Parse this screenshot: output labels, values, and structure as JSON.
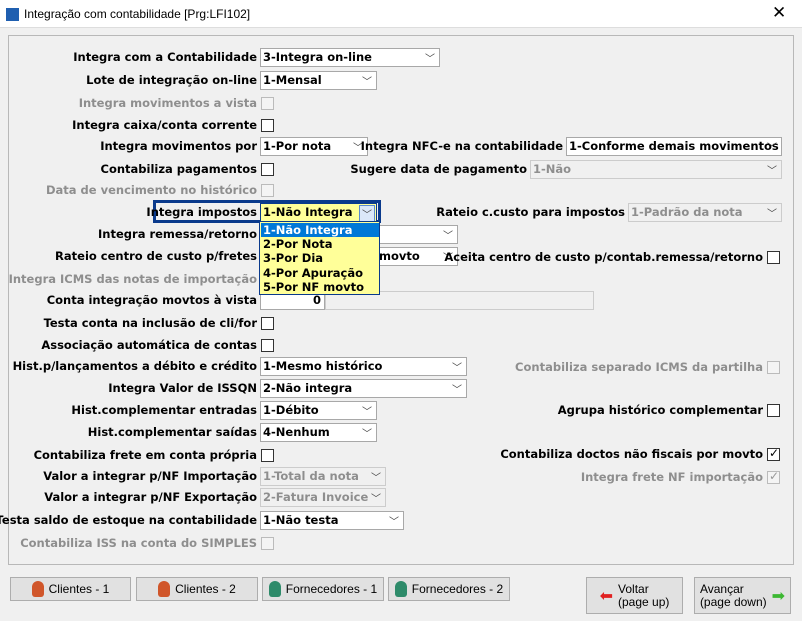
{
  "window": {
    "title": "Integração com contabilidade [Prg:LFI102]",
    "close": "✕"
  },
  "left": {
    "integra_contab": {
      "label": "Integra com a Contabilidade",
      "value": "3-Integra on-line"
    },
    "lote": {
      "label": "Lote de integração on-line",
      "value": "1-Mensal"
    },
    "mov_vista": {
      "label": "Integra movimentos a vista"
    },
    "caixa": {
      "label": "Integra caixa/conta corrente"
    },
    "mov_por": {
      "label": "Integra movimentos por",
      "value": "1-Por nota"
    },
    "pagamentos": {
      "label": "Contabiliza pagamentos"
    },
    "venc_hist": {
      "label": "Data de vencimento no histórico"
    },
    "impostos": {
      "label": "Integra impostos",
      "value": "1-Não Integra"
    },
    "remessa": {
      "label": "Integra remessa/retorno"
    },
    "rateio_fretes": {
      "label": "Rateio centro de custo p/fretes",
      "value": "movto"
    },
    "icms_import": {
      "label": "Integra ICMS das notas de importação"
    },
    "conta_vista": {
      "label": "Conta integração movtos à vista",
      "value": "0"
    },
    "testa_conta": {
      "label": "Testa conta na inclusão de cli/for"
    },
    "assoc": {
      "label": "Associação automática de contas"
    },
    "hist_lanc": {
      "label": "Hist.p/lançamentos a débito e crédito",
      "value": "1-Mesmo histórico"
    },
    "issqn": {
      "label": "Integra Valor de ISSQN",
      "value": "2-Não integra"
    },
    "hist_ent": {
      "label": "Hist.complementar entradas",
      "value": "1-Débito"
    },
    "hist_sai": {
      "label": "Hist.complementar saídas",
      "value": "4-Nenhum"
    },
    "frete": {
      "label": "Contabiliza frete em conta própria"
    },
    "val_imp": {
      "label": "Valor a integrar p/NF Importação",
      "value": "1-Total da nota"
    },
    "val_exp": {
      "label": "Valor a integrar p/NF Exportação",
      "value": "2-Fatura Invoice"
    },
    "testa_saldo": {
      "label": "Testa saldo de estoque na contabilidade",
      "value": "1-Não testa"
    },
    "iss_simples": {
      "label": "Contabiliza ISS na conta do SIMPLES"
    }
  },
  "right": {
    "nfce": {
      "label": "Integra NFC-e na contabilidade",
      "value": "1-Conforme demais movimentos"
    },
    "sugere": {
      "label": "Sugere data de pagamento",
      "value": "1-Não"
    },
    "rateio_imp": {
      "label": "Rateio c.custo para impostos",
      "value": "1-Padrão da nota"
    },
    "aceita": {
      "label": "Aceita centro de custo p/contab.remessa/retorno",
      "checked": false
    },
    "icms_partilha": {
      "label": "Contabiliza separado ICMS da partilha",
      "checked": false
    },
    "agrupa": {
      "label": "Agrupa histórico complementar",
      "checked": false
    },
    "doctos": {
      "label": "Contabiliza doctos não fiscais por movto",
      "checked": true
    },
    "frete_imp": {
      "label": "Integra frete NF importação",
      "checked": true
    }
  },
  "dropdown": {
    "options": [
      "1-Não Integra",
      "2-Por Nota",
      "3-Por Dia",
      "4-Por Apuração",
      "5-Por NF movto"
    ],
    "selected": 0
  },
  "buttons": {
    "clientes1": "Clientes - 1",
    "clientes2": "Clientes - 2",
    "fornec1": "Fornecedores - 1",
    "fornec2": "Fornecedores - 2",
    "voltar1": "Voltar",
    "voltar2": "(page up)",
    "avancar1": "Avançar",
    "avancar2": "(page down)"
  },
  "colors": {
    "highlight_border": "#0a3a8c",
    "dropdown_bg": "#ffff99",
    "selection": "#0078d7"
  }
}
